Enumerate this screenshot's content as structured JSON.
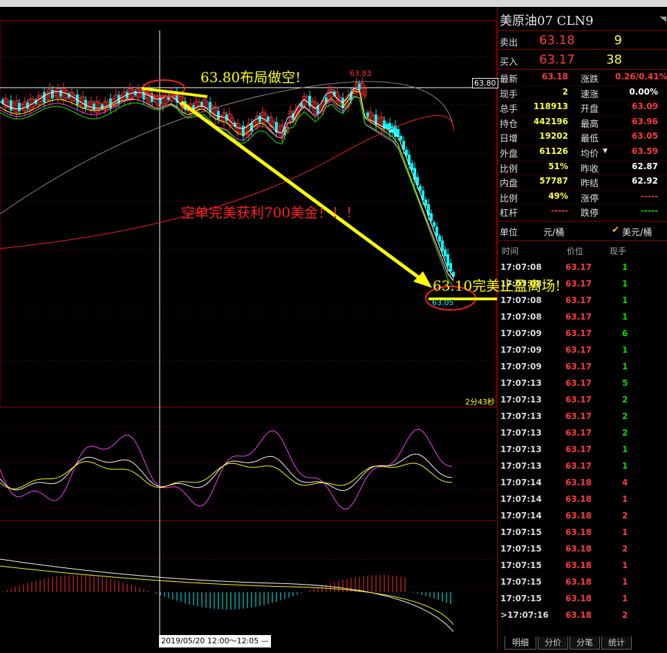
{
  "symbol": "美原油07  CLN9",
  "bid_ask": {
    "sell_label": "卖出",
    "sell_price": "63.18",
    "sell_qty": "9",
    "buy_label": "买入",
    "buy_price": "63.17",
    "buy_qty": "38"
  },
  "quote": [
    {
      "l1": "最新",
      "v1": "63.18",
      "c1": "red",
      "l2": "涨跌",
      "v2": "0.26/0.41%",
      "c2": "red"
    },
    {
      "l1": "现手",
      "v1": "2",
      "c1": "yel",
      "l2": "速涨",
      "v2": "0.00%",
      "c2": "wht"
    },
    {
      "l1": "总手",
      "v1": "118913",
      "c1": "yel",
      "l2": "开盘",
      "v2": "63.09",
      "c2": "red"
    },
    {
      "l1": "持仓",
      "v1": "442196",
      "c1": "yel",
      "l2": "最高",
      "v2": "63.96",
      "c2": "red"
    },
    {
      "l1": "日增",
      "v1": "19202",
      "c1": "yel",
      "l2": "最低",
      "v2": "63.05",
      "c2": "red"
    },
    {
      "l1": "外盘",
      "v1": "61126",
      "c1": "yel",
      "l2": "均价",
      "v2": "63.59",
      "c2": "red"
    },
    {
      "l1": "比例",
      "v1": "51%",
      "c1": "yel",
      "l2": "昨收",
      "v2": "62.87",
      "c2": "wht"
    },
    {
      "l1": "内盘",
      "v1": "57787",
      "c1": "yel",
      "l2": "昨结",
      "v2": "62.92",
      "c2": "wht"
    },
    {
      "l1": "比例",
      "v1": "49%",
      "c1": "yel",
      "l2": "涨停",
      "v2": "-----",
      "c2": "red"
    },
    {
      "l1": "杠杆",
      "v1": "-----",
      "c1": "red",
      "l2": "跌停",
      "v2": "-----",
      "c2": "grn"
    }
  ],
  "unit": {
    "label": "单位",
    "opt1": "元/桶",
    "check": "✔",
    "opt2": "美元/桶"
  },
  "ticks_header": {
    "time": "时间",
    "price": "价位",
    "qty": "现手"
  },
  "ticks": [
    {
      "t": "17:07:08",
      "p": "63.17",
      "q": "1",
      "qc": "grn"
    },
    {
      "t": "17:07:08",
      "p": "63.17",
      "q": "1",
      "qc": "grn"
    },
    {
      "t": "17:07:08",
      "p": "63.17",
      "q": "1",
      "qc": "grn"
    },
    {
      "t": "17:07:08",
      "p": "63.17",
      "q": "1",
      "qc": "grn"
    },
    {
      "t": "17:07:09",
      "p": "63.17",
      "q": "6",
      "qc": "grn"
    },
    {
      "t": "17:07:09",
      "p": "63.17",
      "q": "1",
      "qc": "grn"
    },
    {
      "t": "17:07:09",
      "p": "63.17",
      "q": "1",
      "qc": "grn"
    },
    {
      "t": "17:07:13",
      "p": "63.17",
      "q": "5",
      "qc": "grn"
    },
    {
      "t": "17:07:13",
      "p": "63.17",
      "q": "2",
      "qc": "grn"
    },
    {
      "t": "17:07:13",
      "p": "63.17",
      "q": "2",
      "qc": "grn"
    },
    {
      "t": "17:07:13",
      "p": "63.17",
      "q": "2",
      "qc": "grn"
    },
    {
      "t": "17:07:13",
      "p": "63.17",
      "q": "1",
      "qc": "grn"
    },
    {
      "t": "17:07:13",
      "p": "63.17",
      "q": "1",
      "qc": "grn"
    },
    {
      "t": "17:07:14",
      "p": "63.18",
      "q": "4",
      "qc": "red"
    },
    {
      "t": "17:07:14",
      "p": "63.18",
      "q": "1",
      "qc": "red"
    },
    {
      "t": "17:07:14",
      "p": "63.18",
      "q": "2",
      "qc": "red"
    },
    {
      "t": "17:07:15",
      "p": "63.18",
      "q": "1",
      "qc": "red"
    },
    {
      "t": "17:07:15",
      "p": "63.18",
      "q": "2",
      "qc": "red"
    },
    {
      "t": "17:07:15",
      "p": "63.18",
      "q": "1",
      "qc": "red"
    },
    {
      "t": "17:07:15",
      "p": "63.18",
      "q": "1",
      "qc": "red"
    },
    {
      "t": "17:07:15",
      "p": "63.18",
      "q": "1",
      "qc": "red"
    },
    {
      "t": ">17:07:16",
      "p": "63.18",
      "q": "2",
      "qc": "red"
    }
  ],
  "tabs": [
    "明细",
    "分价",
    "分笔",
    "统计"
  ],
  "chart": {
    "high_label": "63.83",
    "low_label": "63.05",
    "price_line_label": "63.80",
    "countdown": "2分43秒",
    "date_range": "2019/05/20 12:00～12:05 —",
    "annotation_short": "63.80布局做空!",
    "annotation_profit": "空单完美获利700美金！！！",
    "annotation_exit": "63.10完美止盈离场!"
  },
  "colors": {
    "up": "#ff3030",
    "down": "#00ffff",
    "accent": "#ffff00",
    "border": "#a00000"
  }
}
